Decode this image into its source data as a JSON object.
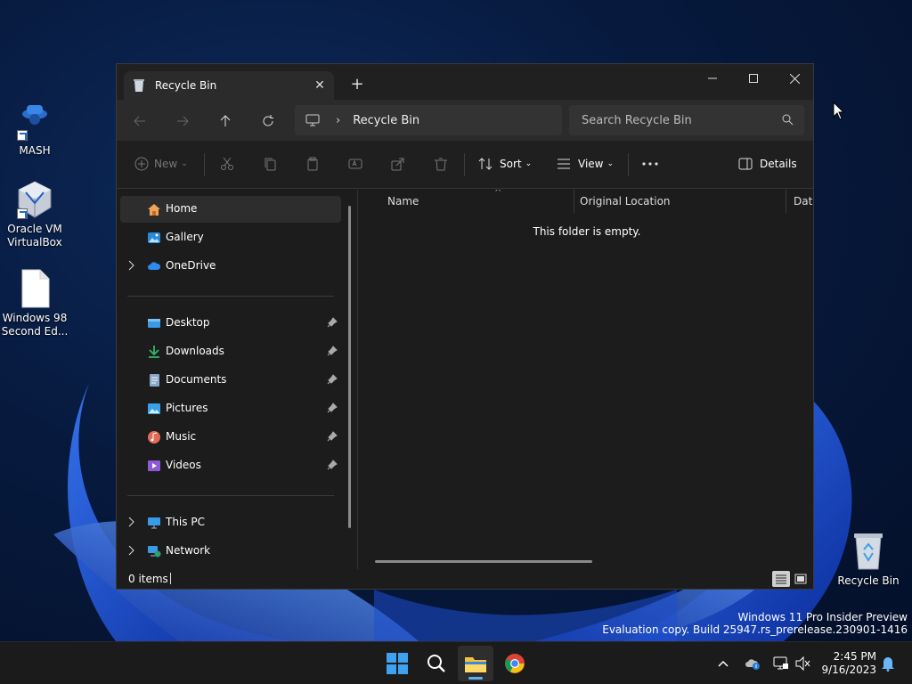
{
  "desktop": {
    "icons": [
      {
        "label": "MASH"
      },
      {
        "label": "Oracle VM VirtualBox"
      },
      {
        "label": "Windows 98 Second Ed..."
      },
      {
        "label": "Recycle Bin"
      }
    ],
    "watermark_line1": "Windows 11 Pro Insider Preview",
    "watermark_line2": "Evaluation copy. Build 25947.rs_prerelease.230901-1416"
  },
  "window": {
    "tab_title": "Recycle Bin",
    "address": {
      "crumb": "Recycle Bin"
    },
    "search": {
      "placeholder": "Search Recycle Bin"
    },
    "commands": {
      "new_label": "New",
      "sort_label": "Sort",
      "view_label": "View",
      "details_label": "Details"
    },
    "sidebar": {
      "items": [
        {
          "label": "Home"
        },
        {
          "label": "Gallery"
        },
        {
          "label": "OneDrive"
        },
        {
          "label": "Desktop"
        },
        {
          "label": "Downloads"
        },
        {
          "label": "Documents"
        },
        {
          "label": "Pictures"
        },
        {
          "label": "Music"
        },
        {
          "label": "Videos"
        },
        {
          "label": "This PC"
        },
        {
          "label": "Network"
        }
      ]
    },
    "columns": [
      "Name",
      "Original Location",
      "Date"
    ],
    "empty_message": "This folder is empty.",
    "status": {
      "items_text": "0 items"
    }
  },
  "taskbar": {
    "time": "2:45 PM",
    "date": "9/16/2023"
  },
  "colors": {
    "accent": "#5fb2f2",
    "window_bg": "#1c1c1c",
    "taskbar_bg": "#1b1b1b"
  }
}
